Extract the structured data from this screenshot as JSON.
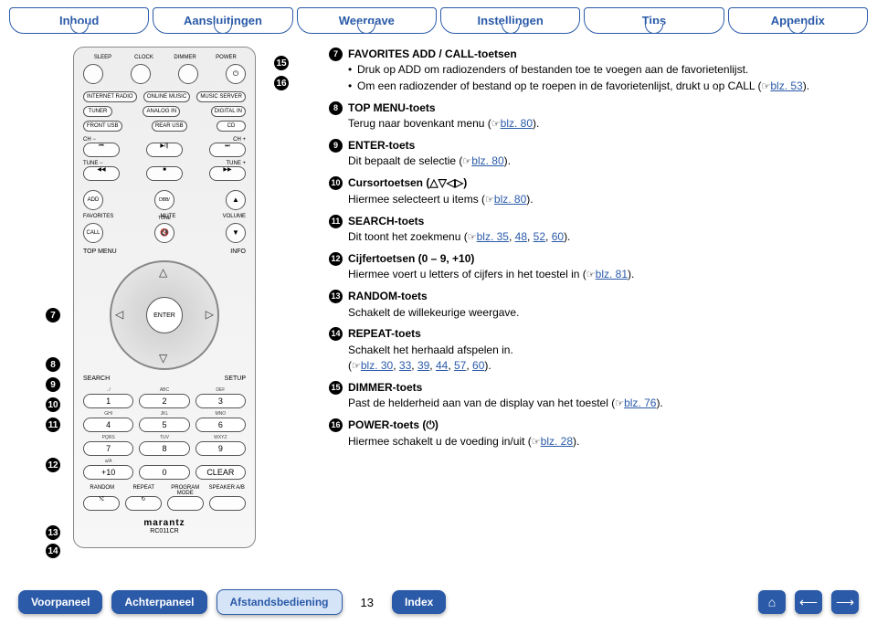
{
  "top_tabs": [
    "Inhoud",
    "Aansluitingen",
    "Weergave",
    "Instellingen",
    "Tips",
    "Appendix"
  ],
  "remote": {
    "row1": [
      "SLEEP",
      "CLOCK",
      "DIMMER",
      "POWER"
    ],
    "row2": [
      "INTERNET RADIO",
      "ONLINE MUSIC",
      "MUSIC SERVER"
    ],
    "row3": [
      "TUNER",
      "ANALOG IN",
      "DIGITAL IN"
    ],
    "row4": [
      "FRONT USB",
      "REAR USB",
      "CD"
    ],
    "ch_minus": "CH −",
    "ch_plus": "CH +",
    "tune_minus": "TUNE −",
    "tune_plus": "TUNE +",
    "add": "ADD",
    "dbb": "DBB/ TONE",
    "favorites": "FAVORITES",
    "mute": "MUTE",
    "volume": "VOLUME",
    "call": "CALL",
    "topmenu": "TOP MENU",
    "info": "INFO",
    "enter": "ENTER",
    "search": "SEARCH",
    "setup": "SETUP",
    "num_subs": [
      ". /",
      "ABC",
      "DEF",
      "GHI",
      "JKL",
      "MNO",
      "PQRS",
      "TUV",
      "WXYZ",
      "a/A",
      "  ",
      ""
    ],
    "num_keys": [
      "1",
      "2",
      "3",
      "4",
      "5",
      "6",
      "7",
      "8",
      "9",
      "+10",
      "0",
      "CLEAR"
    ],
    "bottom4": [
      "RANDOM",
      "REPEAT",
      "PROGRAM MODE",
      "SPEAKER A/B"
    ],
    "brand": "marantz",
    "model": "RC011CR"
  },
  "desc": {
    "i7": {
      "title": "FAVORITES ADD / CALL-toetsen",
      "body1": "Druk op ADD om radiozenders of bestanden toe te voegen aan de favorietenlijst.",
      "body2": "Om een radiozender of bestand op te roepen in de favorietenlijst, drukt u op CALL (",
      "pg2": "blz. 53",
      "body2b": ")."
    },
    "i8": {
      "title": "TOP MENU-toets",
      "body": "Terug naar bovenkant menu (",
      "pg": "blz. 80",
      "bodyb": ")."
    },
    "i9": {
      "title": "ENTER-toets",
      "body": "Dit bepaalt de selectie (",
      "pg": "blz. 80",
      "bodyb": ")."
    },
    "i10": {
      "title": "Cursortoetsen (△▽◁▷)",
      "body": "Hiermee selecteert u items (",
      "pg": "blz. 80",
      "bodyb": ")."
    },
    "i11": {
      "title": "SEARCH-toets",
      "body": "Dit toont het zoekmenu (",
      "pgs": [
        "blz. 35",
        "48",
        "52",
        "60"
      ],
      "bodyb": ")."
    },
    "i12": {
      "title": "Cijfertoetsen (0 – 9, +10)",
      "body": "Hiermee voert u letters of cijfers in het toestel in (",
      "pg": "blz. 81",
      "bodyb": ")."
    },
    "i13": {
      "title": "RANDOM-toets",
      "body": "Schakelt de willekeurige weergave."
    },
    "i14": {
      "title": "REPEAT-toets",
      "body": "Schakelt het herhaald afspelen in.",
      "body2": "(",
      "pgs": [
        "blz. 30",
        "33",
        "39",
        "44",
        "57",
        "60"
      ],
      "body2b": ")."
    },
    "i15": {
      "title": "DIMMER-toets",
      "body": "Past de helderheid aan van de display van het toestel (",
      "pg": "blz. 76",
      "bodyb": ")."
    },
    "i16": {
      "title": "POWER-toets (⏻)",
      "body": "Hiermee schakelt u de voeding in/uit (",
      "pg": "blz. 28",
      "bodyb": ")."
    }
  },
  "foot": {
    "b1": "Voorpaneel",
    "b2": "Achterpaneel",
    "b3": "Afstandsbediening",
    "pagenum": "13",
    "b4": "Index"
  }
}
